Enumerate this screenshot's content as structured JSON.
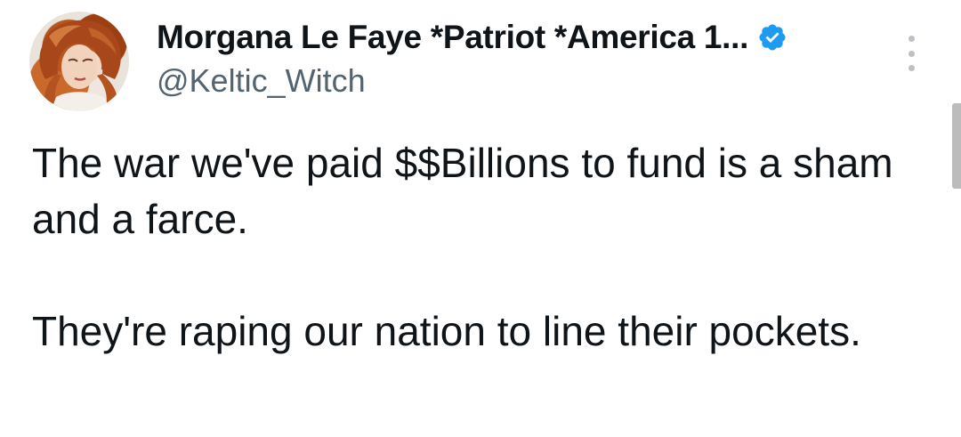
{
  "author": {
    "display_name": "Morgana Le Faye *Patriot *America 1...",
    "handle": "@Keltic_Witch",
    "verified": true
  },
  "tweet": {
    "paragraph_1": "The war we've paid $$Billions to fund is a sham and a farce.",
    "paragraph_2": "They're raping our nation to line their pockets."
  },
  "icons": {
    "verified": "verified-badge-icon",
    "more": "more-options-icon"
  },
  "colors": {
    "verified_blue": "#1d9bf0",
    "text": "#0f1419",
    "secondary_text": "#536471"
  }
}
